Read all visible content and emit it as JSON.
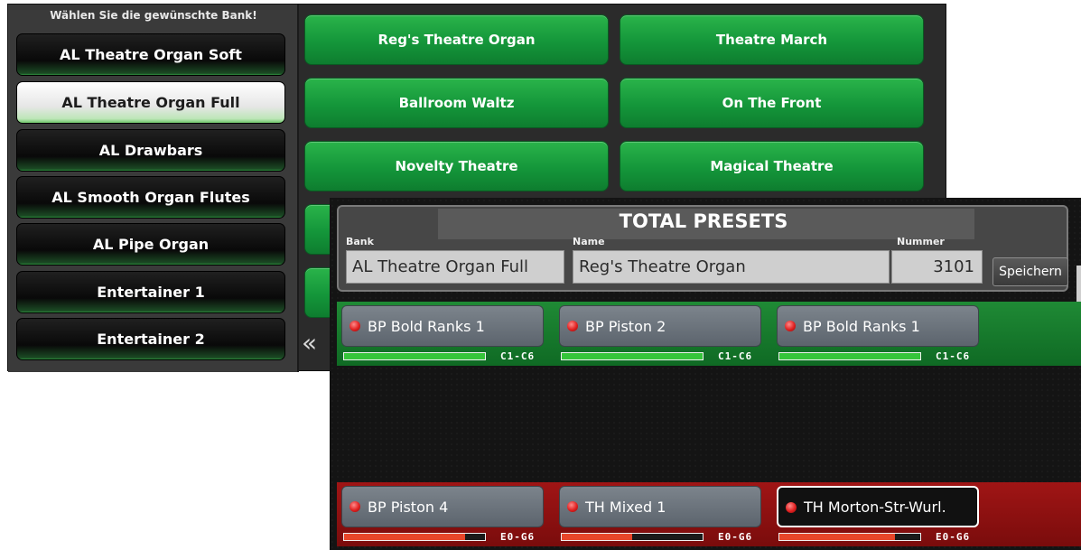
{
  "bank_panel": {
    "heading": "Wählen Sie die gewünschte Bank!",
    "banks": [
      {
        "label": "AL Theatre Organ Soft",
        "selected": false
      },
      {
        "label": "AL Theatre Organ Full",
        "selected": true
      },
      {
        "label": "AL Drawbars",
        "selected": false
      },
      {
        "label": "AL Smooth Organ Flutes",
        "selected": false
      },
      {
        "label": "AL Pipe Organ",
        "selected": false
      },
      {
        "label": "Entertainer 1",
        "selected": false
      },
      {
        "label": "Entertainer 2",
        "selected": false
      }
    ],
    "presets": [
      "Reg's Theatre Organ",
      "Theatre March",
      "Ballroom Waltz",
      "On The Front",
      "Novelty Theatre",
      "Magical Theatre"
    ],
    "back_icon": "double-chevron-left-icon",
    "back_glyph": "«"
  },
  "total_presets": {
    "title": "TOTAL PRESETS",
    "bank_label": "Bank",
    "bank_value": "AL Theatre Organ Full",
    "name_label": "Name",
    "name_value": "Reg's Theatre Organ",
    "number_label": "Nummer",
    "number_value": "3101",
    "save_label": "Speichern"
  },
  "upper_track": {
    "color": "#1f8a35",
    "slots": [
      {
        "label": "BP Bold Ranks 1",
        "range": "C1-C6",
        "level": 1.0,
        "fill_color": "#35c53a"
      },
      {
        "label": "BP Piston 2",
        "range": "C1-C6",
        "level": 1.0,
        "fill_color": "#35c53a"
      },
      {
        "label": "BP Bold Ranks 1",
        "range": "C1-C6",
        "level": 1.0,
        "fill_color": "#35c53a"
      }
    ]
  },
  "lower_track": {
    "color": "#a01515",
    "slots": [
      {
        "label": "BP Piston 4",
        "range": "E0-G6",
        "level": 0.86,
        "fill_color": "#e8462a",
        "selected": false
      },
      {
        "label": "TH Mixed 1",
        "range": "E0-G6",
        "level": 0.5,
        "fill_color": "#e8462a",
        "selected": false
      },
      {
        "label": "TH Morton-Str-Wurl.",
        "range": "E0-G6",
        "level": 0.82,
        "fill_color": "#e8462a",
        "selected": true
      }
    ]
  }
}
